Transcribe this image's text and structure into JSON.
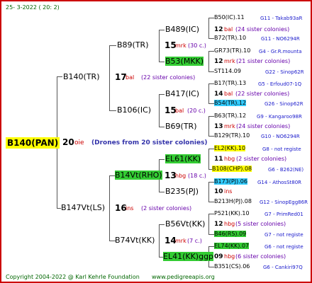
{
  "header": "25-  3-2022 ( 20:  2)",
  "root": {
    "name": "B140(PAN)",
    "number": "20",
    "code": "oie",
    "note": "(Drones from 20 sister colonies)"
  },
  "g1": [
    {
      "name": "B140(TR)",
      "number": "17",
      "code": "bal",
      "colonies": "(22 sister colonies)"
    },
    {
      "name": "B147Vt(LS)",
      "number": "16",
      "code": "ins",
      "colonies": "(2 sister colonies)"
    }
  ],
  "g2": [
    {
      "name": "B89(TR)",
      "number": "15",
      "code": "mrk",
      "colonies": "(30 c.)"
    },
    {
      "name": "B106(IC)",
      "number": "15",
      "code": "bal",
      "colonies": "(20 c.)"
    },
    {
      "name": "B14Vt(RHO)",
      "number": "13",
      "code": "hbg",
      "colonies": "(18 c.)"
    },
    {
      "name": "B74Vt(KK)",
      "number": "14",
      "code": "mrk",
      "colonies": "(7 c.)"
    }
  ],
  "g3": [
    {
      "name": "B489(IC)",
      "number": "12",
      "code": "bal",
      "colonies": "(24 sister colonies)"
    },
    {
      "name": "B53(MKK)",
      "number": "12",
      "code": "mrk",
      "colonies": "(21 sister colonies)"
    },
    {
      "name": "B417(IC)",
      "number": "14",
      "code": "bal",
      "colonies": "(22 sister colonies)"
    },
    {
      "name": "B69(TR)",
      "number": "13",
      "code": "mrk",
      "colonies": "(24 sister colonies)"
    },
    {
      "name": "EL61(KK)",
      "number": "11",
      "code": "hbg",
      "colonies": "(2 sister colonies)"
    },
    {
      "name": "B235(PJ)",
      "number": "10",
      "code": "ins",
      "colonies": ""
    },
    {
      "name": "B56Vt(KK)",
      "number": "12",
      "code": "hbg",
      "colonies": "(5 sister colonies)"
    },
    {
      "name": "EL41(KK)ggp",
      "number": "09",
      "code": "hbg",
      "colonies": "(6 sister colonies)"
    }
  ],
  "g4": [
    {
      "name": "B50(IC).11",
      "ref": "G11 - Takab93aR"
    },
    {
      "name": "B72(TR).10",
      "ref": "G11 - NO6294R"
    },
    {
      "name": "GR73(TR).10",
      "ref": "G4 - Gr.R.mounta"
    },
    {
      "name": "ST114.09",
      "ref": "G22 - Sinop62R"
    },
    {
      "name": "B17(TR).13",
      "ref": "G5 - Erfoud07-1Q"
    },
    {
      "name": "B54(TR).12",
      "ref": "G26 - Sinop62R"
    },
    {
      "name": "B63(TR).12",
      "ref": "G9 - Kangaroo98R"
    },
    {
      "name": "B129(TR).10",
      "ref": "G10 - NO6294R"
    },
    {
      "name": "EL2(KK).10",
      "ref": "G8 - not registe"
    },
    {
      "name": "B108(CHP).08",
      "ref": "G6 - B262(NE)"
    },
    {
      "name": "B173(PJ).06",
      "ref": "G14 - AthosSt80R"
    },
    {
      "name": "B213H(PJ).08",
      "ref": "G12 - SinopEgg86R"
    },
    {
      "name": "P521(KK).10",
      "ref": "G7 - PrimRed01"
    },
    {
      "name": "B46(RS).09",
      "ref": "G7 - not registe"
    },
    {
      "name": "EL74(KK).07",
      "ref": "G6 - not registe"
    },
    {
      "name": "B351(CS).06",
      "ref": "G6 - Cankiri97Q"
    }
  ],
  "footer_left": "Copyright 2004-2022 @ Karl Kehrle Foundation",
  "footer_right": "www.pedigreeapis.org"
}
